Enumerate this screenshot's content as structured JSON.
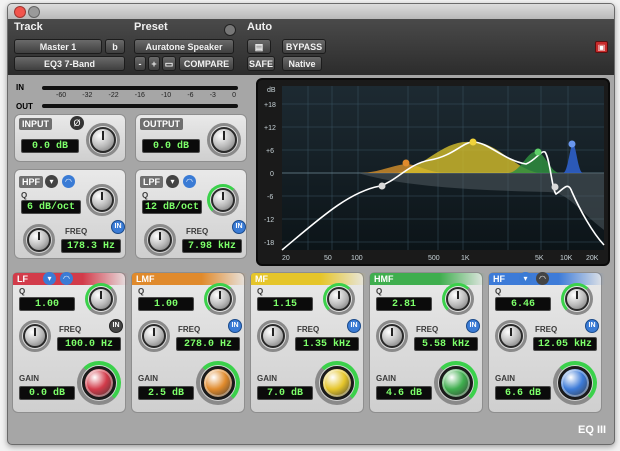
{
  "header": {
    "track_label": "Track",
    "preset_label": "Preset",
    "auto_label": "Auto",
    "track_name": "Master 1",
    "track_channel": "b",
    "plugin_name": "EQ3 7-Band",
    "preset_name": "Auratone Speaker",
    "compare_label": "COMPARE",
    "bypass_label": "BYPASS",
    "safe_label": "SAFE",
    "native_label": "Native",
    "minus": "-",
    "plus": "+"
  },
  "meters": {
    "in_label": "IN",
    "out_label": "OUT",
    "scale": [
      "-60",
      "-32",
      "-22",
      "-16",
      "-10",
      "-6",
      "-3",
      "0"
    ]
  },
  "input": {
    "label": "INPUT",
    "value": "0.0 dB",
    "phase_symbol": "Ø"
  },
  "output": {
    "label": "OUTPUT",
    "value": "0.0 dB"
  },
  "hpf": {
    "label": "HPF",
    "q_label": "Q",
    "q_value": "6 dB/oct",
    "freq_label": "FREQ",
    "freq_value": "178.3 Hz",
    "in_label": "IN"
  },
  "lpf": {
    "label": "LPF",
    "q_label": "Q",
    "q_value": "12 dB/oct",
    "freq_label": "FREQ",
    "freq_value": "7.98 kHz",
    "in_label": "IN"
  },
  "graph": {
    "y_labels": [
      "dB",
      "+18",
      "+12",
      "+6",
      "0",
      "-6",
      "-12",
      "-18"
    ],
    "x_labels": [
      "20",
      "50",
      "100",
      "500",
      "1K",
      "5K",
      "10K",
      "20K"
    ]
  },
  "bands": [
    {
      "name": "LF",
      "q_label": "Q",
      "q_value": "1.00",
      "freq_label": "FREQ",
      "freq_value": "100.0 Hz",
      "gain_label": "GAIN",
      "gain_value": "0.0 dB",
      "in_label": "IN",
      "color": "#d23b4a"
    },
    {
      "name": "LMF",
      "q_label": "Q",
      "q_value": "1.00",
      "freq_label": "FREQ",
      "freq_value": "278.0 Hz",
      "gain_label": "GAIN",
      "gain_value": "2.5 dB",
      "in_label": "IN",
      "color": "#e08a2c"
    },
    {
      "name": "MF",
      "q_label": "Q",
      "q_value": "1.15",
      "freq_label": "FREQ",
      "freq_value": "1.35 kHz",
      "gain_label": "GAIN",
      "gain_value": "7.0 dB",
      "in_label": "IN",
      "color": "#e5c52a"
    },
    {
      "name": "HMF",
      "q_label": "Q",
      "q_value": "2.81",
      "freq_label": "FREQ",
      "freq_value": "5.58 kHz",
      "gain_label": "GAIN",
      "gain_value": "4.6 dB",
      "in_label": "IN",
      "color": "#3fae4e"
    },
    {
      "name": "HF",
      "q_label": "Q",
      "q_value": "6.46",
      "freq_label": "FREQ",
      "freq_value": "12.05 kHz",
      "gain_label": "GAIN",
      "gain_value": "6.6 dB",
      "in_label": "IN",
      "color": "#3d7bd8"
    }
  ],
  "footer": {
    "logo": "EQ III"
  }
}
